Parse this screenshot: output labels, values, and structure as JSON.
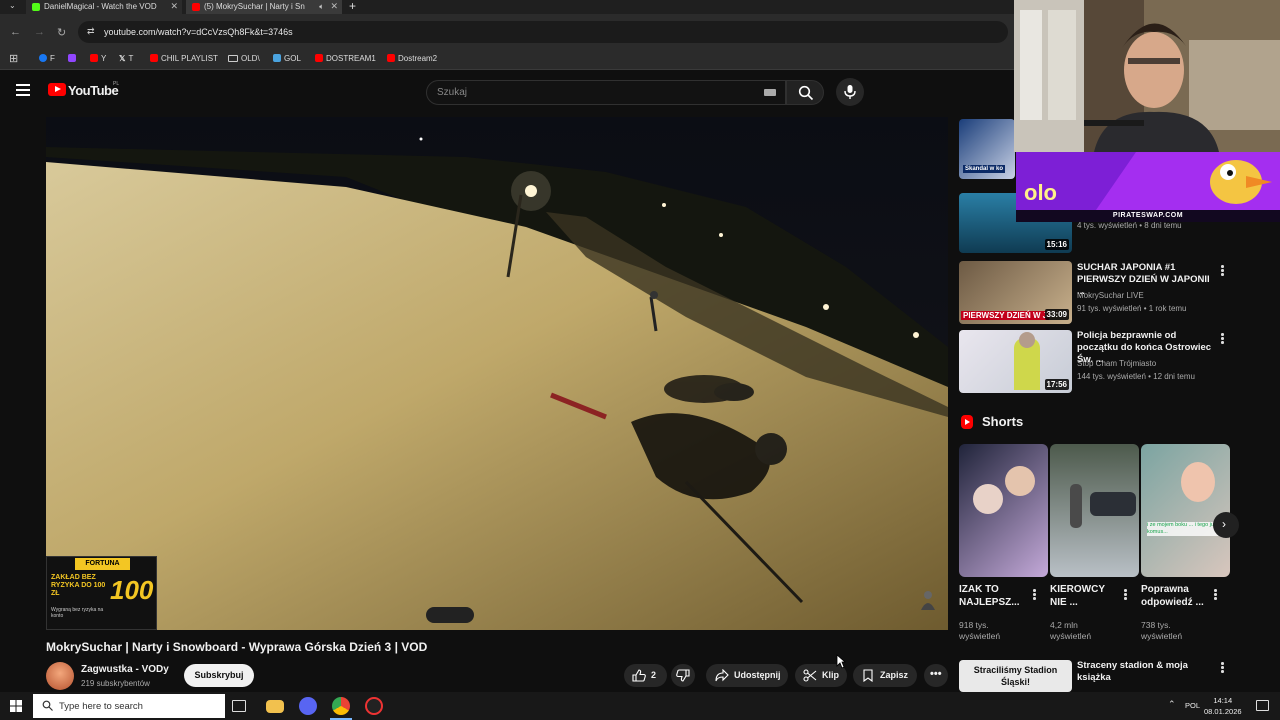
{
  "browser": {
    "tabs": [
      {
        "title": "DanielMagical - Watch the VOD",
        "favicon_color": "#53fc18"
      },
      {
        "title": "(5) MokrySuchar | Narty i Sn",
        "favicon_color": "#ff0000"
      }
    ],
    "new_tab": "+",
    "url": "youtube.com/watch?v=dCcVzsQh8Fk&t=3746s",
    "bookmarks": [
      {
        "label": "F",
        "color": "#1877f2"
      },
      {
        "label": "",
        "color": "#9146ff"
      },
      {
        "label": "Y",
        "color": "#ff0000"
      },
      {
        "label": "T",
        "color": "#ffffff"
      },
      {
        "label": "CHIL PLAYLIST",
        "color": "#ff0000"
      },
      {
        "label": "OLD\\",
        "color": "#dddddd"
      },
      {
        "label": "GOL",
        "color": "#4aa3df"
      },
      {
        "label": "DOSTREAM1",
        "color": "#ff0000"
      },
      {
        "label": "Dostream2",
        "color": "#ff0000"
      }
    ]
  },
  "youtube": {
    "logo_text": "YouTube",
    "country_code": "PL",
    "search_placeholder": "Szukaj"
  },
  "video": {
    "title": "MokrySuchar | Narty i Snowboard - Wyprawa Górska Dzień 3 | VOD",
    "ad": {
      "brand": "FORTUNA",
      "headline": "ZAKŁAD BEZ RYZYKA DO 100 ZŁ",
      "small": "Wygraną bez ryzyka na konto",
      "amount": "100"
    }
  },
  "channel": {
    "name": "Zagwustka - VODy",
    "subscribers": "219 subskrybentów",
    "subscribe_label": "Subskrybuj"
  },
  "actions": {
    "likes": "2",
    "share": "Udostępnij",
    "clip": "Klip",
    "save": "Zapisz"
  },
  "recommended": [
    {
      "title": "",
      "meta1": "",
      "meta2": "",
      "duration": "",
      "thumb_text": "Skandal w ko",
      "colors": [
        "#1b3e7a",
        "#c9d2e6"
      ]
    },
    {
      "title": "",
      "meta1": "",
      "meta2": "4 tys. wyświetleń • 8 dni temu",
      "duration": "15:16",
      "thumb_text": "",
      "colors": [
        "#2a7fa6",
        "#0f3b52"
      ]
    },
    {
      "title": "SUCHAR JAPONIA #1 PIERWSZY DZIEŃ W JAPONII ...",
      "meta1": "MokrySuchar LIVE",
      "meta2": "91 tys. wyświetleń • 1 rok temu",
      "duration": "33:09",
      "thumb_text": "PIERWSZY DZIEŃ W J",
      "colors": [
        "#6d5a44",
        "#c8b08c"
      ]
    },
    {
      "title": "Policja bezprawnie od początku do końca Ostrowiec Św. ...",
      "meta1": "Stop Cham Trójmiasto",
      "meta2": "144 tys. wyświetleń • 12 dni temu",
      "duration": "17:56",
      "thumb_text": "",
      "colors": [
        "#e9e6ee",
        "#c7ccd6"
      ]
    }
  ],
  "shorts": {
    "label": "Shorts",
    "items": [
      {
        "title": "IZAK TO NAJLEPSZ...",
        "views": "918 tys. wyświetleń",
        "colors": [
          "#20243a",
          "#c4a9d9"
        ]
      },
      {
        "title": "KIEROWCY NIE ...",
        "views": "4,2 mln wyświetleń",
        "colors": [
          "#4d5a4c",
          "#b9c0c6"
        ]
      },
      {
        "title": "Poprawna odpowiedź ...",
        "views": "738 tys. wyświetleń",
        "colors": [
          "#7ba4a1",
          "#d8c6bd"
        ],
        "caption": "i ze mojem boku ... i tego już ... komus..."
      }
    ]
  },
  "last_recommended": {
    "title": "Straceny stadion & moja książka",
    "thumb_text": "Straciliśmy Stadion Śląski!"
  },
  "overlay": {
    "banner_url": "PIRATESWAP.COM",
    "banner_text": "olo"
  },
  "taskbar": {
    "search_placeholder": "Type here to search",
    "language": "POL",
    "time": "14:14",
    "date": "08.01.2026"
  }
}
